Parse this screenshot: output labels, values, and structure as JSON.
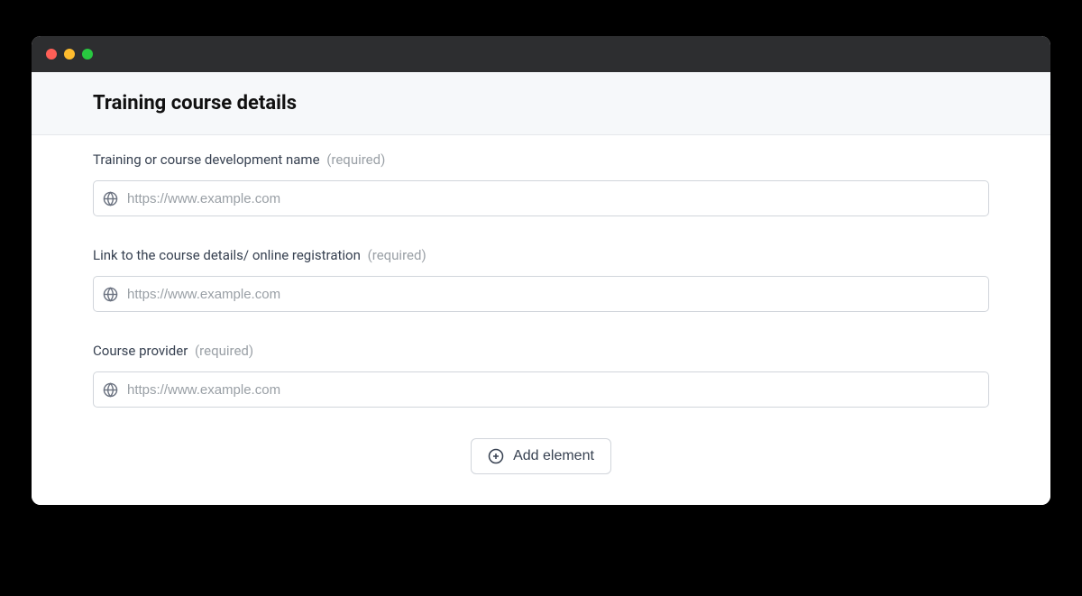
{
  "header": {
    "title": "Training course details"
  },
  "form": {
    "fields": [
      {
        "label": "Training or course development name",
        "required_text": "(required)",
        "placeholder": "https://www.example.com",
        "value": ""
      },
      {
        "label": "Link to the course details/ online registration",
        "required_text": "(required)",
        "placeholder": "https://www.example.com",
        "value": ""
      },
      {
        "label": "Course provider",
        "required_text": "(required)",
        "placeholder": "https://www.example.com",
        "value": ""
      }
    ],
    "add_button_label": "Add element"
  }
}
